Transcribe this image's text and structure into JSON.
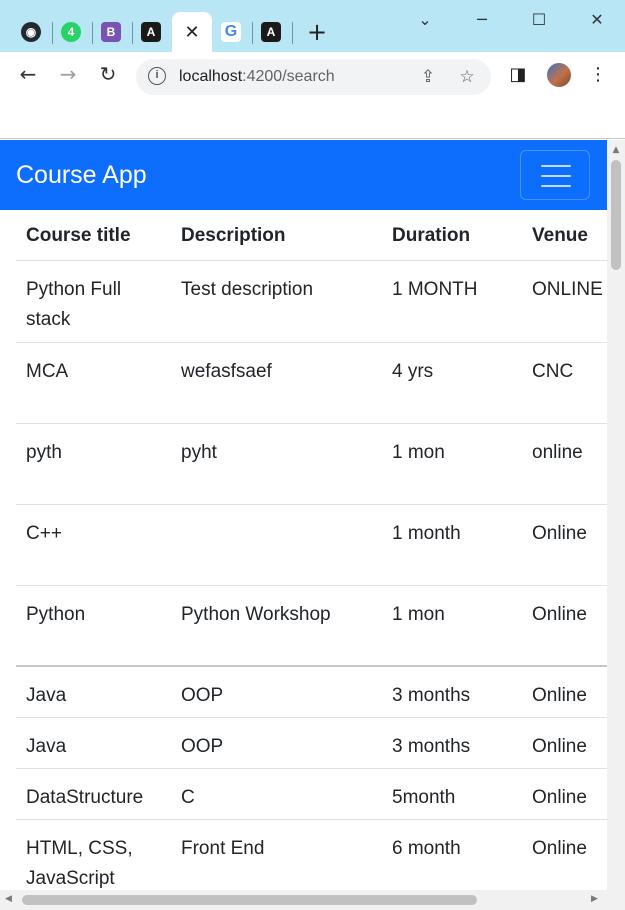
{
  "browser": {
    "url_host": "localhost",
    "url_path": ":4200/search",
    "new_tab_glyph": "+",
    "close_tab_glyph": "✕",
    "tabs": [
      {
        "icon": "github-icon",
        "glyph": "◉",
        "color": "#24292f"
      },
      {
        "icon": "whatsapp-icon",
        "glyph": "4",
        "color": "#25d366"
      },
      {
        "icon": "bootstrap-icon",
        "glyph": "B",
        "color": "#7952b3"
      },
      {
        "icon": "angular-icon",
        "glyph": "A",
        "color": "#1a1a1a"
      },
      {
        "icon": "google-icon",
        "glyph": "G",
        "color": "#4285f4"
      },
      {
        "icon": "angular-icon",
        "glyph": "A",
        "color": "#1a1a1a"
      }
    ]
  },
  "app": {
    "brand": "Course App",
    "accent": "#0d6efd"
  },
  "table": {
    "headers": [
      "Course title",
      "Description",
      "Duration",
      "Venue"
    ],
    "rows": [
      {
        "title": "Python Full stack",
        "description": "Test description",
        "duration": "1 MONTH",
        "venue": "ONLINE"
      },
      {
        "title": "MCA",
        "description": "wefasfsaef",
        "duration": "4 yrs",
        "venue": "CNC"
      },
      {
        "title": "pyth",
        "description": "pyht",
        "duration": "1 mon",
        "venue": "online"
      },
      {
        "title": "C++",
        "description": "",
        "duration": "1 month",
        "venue": "Online"
      },
      {
        "title": "Python",
        "description": "Python Workshop",
        "duration": "1 mon",
        "venue": "Online"
      },
      {
        "title": "Java",
        "description": "OOP",
        "duration": "3 months",
        "venue": "Online"
      },
      {
        "title": "Java",
        "description": "OOP",
        "duration": "3 months",
        "venue": "Online"
      },
      {
        "title": "DataStructure",
        "description": "C",
        "duration": "5month",
        "venue": "Online"
      },
      {
        "title": "HTML, CSS, JavaScript",
        "description": "Front End",
        "duration": "6 month",
        "venue": "Online"
      }
    ]
  }
}
